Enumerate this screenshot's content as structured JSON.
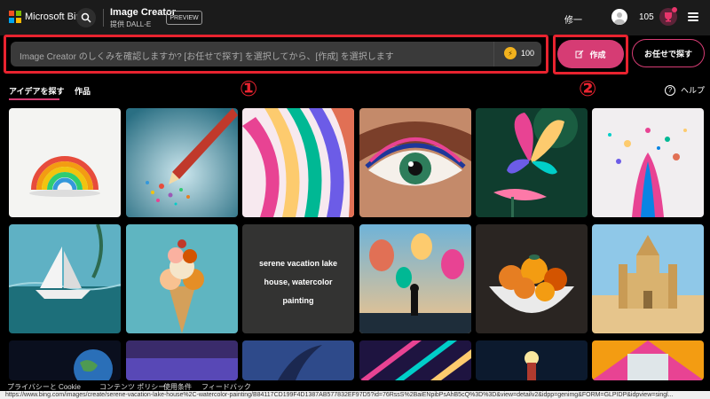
{
  "header": {
    "brand": "Microsoft Bing",
    "title": "Image Creator",
    "subtitle": "提供 DALL-E",
    "badge": "PREVIEW",
    "user_name": "修一",
    "coins": "105"
  },
  "prompt": {
    "placeholder": "Image Creator のしくみを確認しますか? [お任せで探す] を選択してから、[作成] を選択します",
    "boost_count": "100"
  },
  "actions": {
    "create_label": "作成",
    "surprise_label": "お任せで探す"
  },
  "tabs": {
    "explore": "アイデアを探す",
    "creations": "作品"
  },
  "markers": {
    "one": "①",
    "two": "②"
  },
  "help_label": "ヘルプ",
  "gallery": {
    "caption_lines": [
      "serene vacation lake",
      "house, watercolor",
      "painting"
    ]
  },
  "footer": {
    "privacy": "プライバシーと Cookie",
    "content_policy": "コンテンツ ポリシー",
    "terms": "使用条件",
    "feedback": "フィードバック"
  },
  "status_url": "https://www.bing.com/images/create/serene-vacation-lake-house%2C-watercolor-painting/B84117CD199F4D1387AB577832EF97D5?id=76RssS%2BaiENpibPsAhB5cQ%3D%3D&view=detailv2&idpp=genimg&FORM=GLPIDP&idpview=singl...",
  "colors": {
    "accent": "#d63c74",
    "annotation": "#e8232f",
    "header_bg": "#1b1b1b",
    "prompt_bg": "#3a3a3a"
  },
  "icons": [
    "bing-logo-icon",
    "search-icon",
    "avatar-icon",
    "reward-icon",
    "menu-icon",
    "boost-icon",
    "create-icon",
    "help-icon"
  ]
}
